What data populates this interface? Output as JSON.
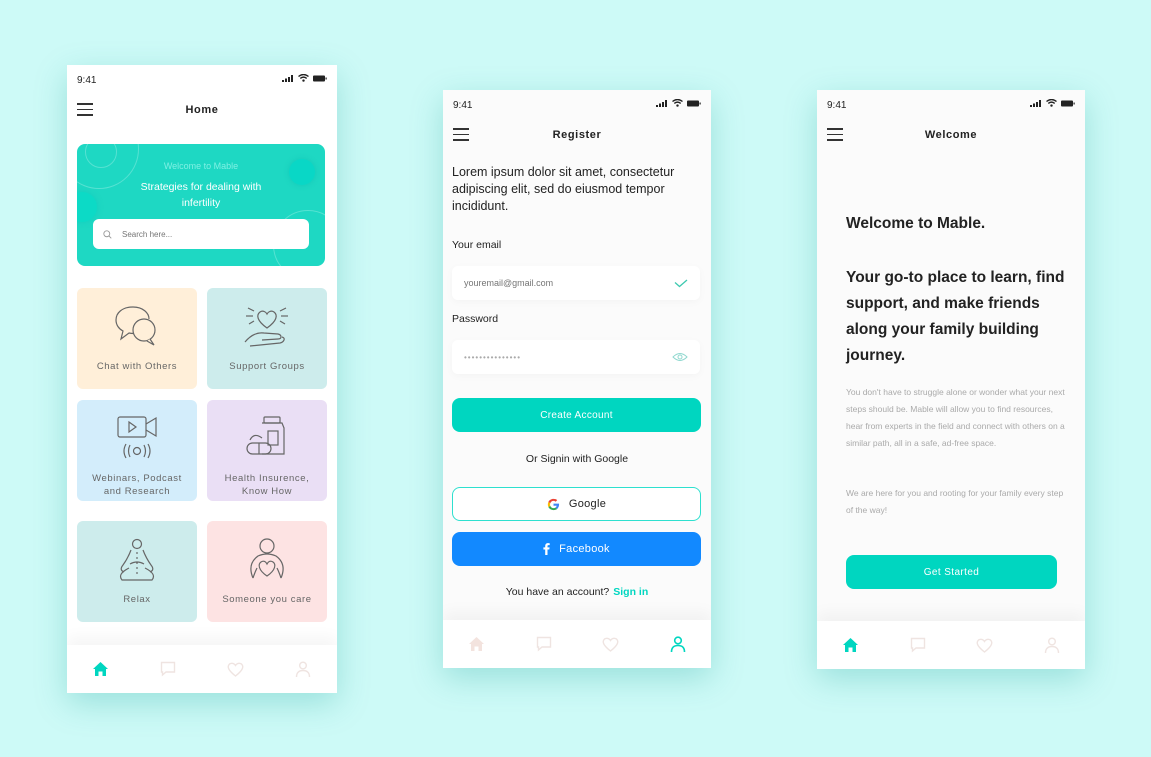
{
  "colors": {
    "background": "#cdfaf7",
    "accent": "#00d6c0",
    "facebook": "#1289ff",
    "nav_inactive": "#efe4e1"
  },
  "status_bar": {
    "time": "9:41"
  },
  "home": {
    "title": "Home",
    "banner": {
      "welcome": "Welcome to Mable",
      "headline": "Strategies for dealing with infertility"
    },
    "search": {
      "placeholder": "Search here..."
    },
    "tiles": [
      {
        "label": "Chat with Others",
        "icon": "chat-bubbles-icon",
        "color": "#ffefd9"
      },
      {
        "label": "Support Groups",
        "icon": "heart-hand-icon",
        "color": "#cdecec"
      },
      {
        "label": "Webinars, Podcast and Research",
        "icon": "video-podcast-icon",
        "color": "#d3edfb"
      },
      {
        "label": "Health Insurence, Know How",
        "icon": "medicine-icon",
        "color": "#eadff5"
      },
      {
        "label": "Relax",
        "icon": "meditation-icon",
        "color": "#cdecec"
      },
      {
        "label": "Someone you care",
        "icon": "person-heart-icon",
        "color": "#fde3e3"
      }
    ],
    "nav_active": "home"
  },
  "register": {
    "title": "Register",
    "lead": "Lorem ipsum dolor sit amet, consectetur adipiscing elit, sed do eiusmod tempor incididunt.",
    "email_label": "Your email",
    "email_placeholder": "youremail@gmail.com",
    "password_label": "Password",
    "password_value": "•••••••••••••••",
    "create_button": "Create Account",
    "or_signin": "Or Signin with Google",
    "google_button": "Google",
    "facebook_button": "Facebook",
    "have_account": "You have an account?",
    "sign_in_link": "Sign in",
    "nav_active": "profile"
  },
  "welcome": {
    "title": "Welcome",
    "heading": "Welcome to Mable.",
    "tagline": "Your go-to place to learn, find support, and make friends along your family building journey.",
    "paragraph1": "You don't have to struggle alone or wonder what your next steps should be.  Mable will allow you to find resources, hear from experts in the field and connect with others on a similar path, all in a safe, ad-free space.",
    "paragraph2": "We are here for you and rooting for your family every step of the way!",
    "start_button": "Get Started",
    "nav_active": "home"
  }
}
